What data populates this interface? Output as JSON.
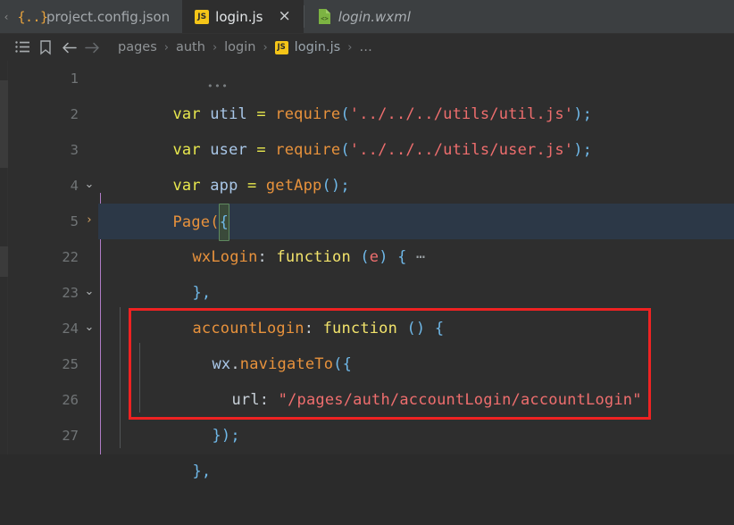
{
  "tabbar": {
    "scroll_left_icon": "chevron-left-icon",
    "tabs": [
      {
        "label": "project.config.json",
        "icon": "json-file-icon",
        "icon_glyph": "{..}",
        "active": false,
        "italic": false,
        "closable": false
      },
      {
        "label": "login.js",
        "icon": "js-file-icon",
        "icon_glyph": "JS",
        "active": true,
        "italic": false,
        "closable": true,
        "close_glyph": "×"
      },
      {
        "label": "login.wxml",
        "icon": "wxml-file-icon",
        "icon_glyph": "<>",
        "active": false,
        "italic": true,
        "closable": false
      }
    ]
  },
  "breadcrumb": {
    "icons": [
      {
        "name": "structure-list-icon",
        "glyph": "☰"
      },
      {
        "name": "bookmark-icon",
        "glyph": "☐"
      },
      {
        "name": "navigate-back-icon",
        "glyph": "←"
      },
      {
        "name": "navigate-forward-icon",
        "glyph": "→"
      }
    ],
    "crumbs": [
      {
        "label": "pages"
      },
      {
        "label": "auth"
      },
      {
        "label": "login"
      },
      {
        "label": "login.js",
        "icon": "js-file-icon",
        "icon_glyph": "JS"
      },
      {
        "label": "…"
      }
    ],
    "separator": "›"
  },
  "editor": {
    "file": "login.js",
    "inline_hint_dots": "•••",
    "lines": [
      {
        "number": "1",
        "fold": "",
        "highlight": false
      },
      {
        "number": "2",
        "fold": "",
        "highlight": false
      },
      {
        "number": "3",
        "fold": "",
        "highlight": false
      },
      {
        "number": "4",
        "fold": "expanded",
        "highlight": false
      },
      {
        "number": "5",
        "fold": "collapsed",
        "highlight": true
      },
      {
        "number": "22",
        "fold": "",
        "highlight": false
      },
      {
        "number": "23",
        "fold": "expanded",
        "highlight": false
      },
      {
        "number": "24",
        "fold": "expanded",
        "highlight": false
      },
      {
        "number": "25",
        "fold": "",
        "highlight": false
      },
      {
        "number": "26",
        "fold": "",
        "highlight": false
      },
      {
        "number": "27",
        "fold": "",
        "highlight": false
      }
    ],
    "code": {
      "l1": {
        "kw": "var",
        "id": "util",
        "eq": "=",
        "fn": "require",
        "open": "(",
        "str": "'../../../utils/util.js'",
        "close": ");"
      },
      "l2": {
        "kw": "var",
        "id": "user",
        "eq": "=",
        "fn": "require",
        "open": "(",
        "str": "'../../../utils/user.js'",
        "close": ");"
      },
      "l3": {
        "kw": "var",
        "id": "app",
        "eq": "=",
        "fn": "getApp",
        "call": "();"
      },
      "l4": {
        "fn": "Page",
        "open": "(",
        "brace": "{"
      },
      "l5": {
        "prop": "wxLogin",
        "colon": ":",
        "func": "function",
        "open": "(",
        "param": "e",
        "close": ")",
        "brace": "{",
        "ellipsis": "⋯"
      },
      "l22": {
        "text": "},"
      },
      "l23": {
        "prop": "accountLogin",
        "colon": ":",
        "func": "function",
        "parens": "()",
        "brace": "{"
      },
      "l24": {
        "obj": "wx",
        "dot": ".",
        "fn": "navigateTo",
        "open": "({"
      },
      "l25": {
        "prop": "url",
        "colon": ":",
        "str": "\"/pages/auth/accountLogin/accountLogin\""
      },
      "l26": {
        "text": "});"
      },
      "l27": {
        "text": "},"
      }
    },
    "fold_glyph_expanded": "⌄",
    "fold_glyph_collapsed": "›"
  },
  "annotation": {
    "name": "red-highlight-rectangle",
    "color": "#ee2222"
  },
  "colors": {
    "editor_bg": "#2e2e2e",
    "tabbar_bg": "#3c3f41",
    "active_line_bg": "#2c3847",
    "keyword": "#e8e84e",
    "function": "#e8923c",
    "string": "#ef6e6e",
    "punctuation": "#6fb8e8",
    "js_icon": "#f5c518",
    "wxml_icon": "#7cb342",
    "indent_guide_active": "#b07cc6",
    "annotation": "#ee2222"
  }
}
